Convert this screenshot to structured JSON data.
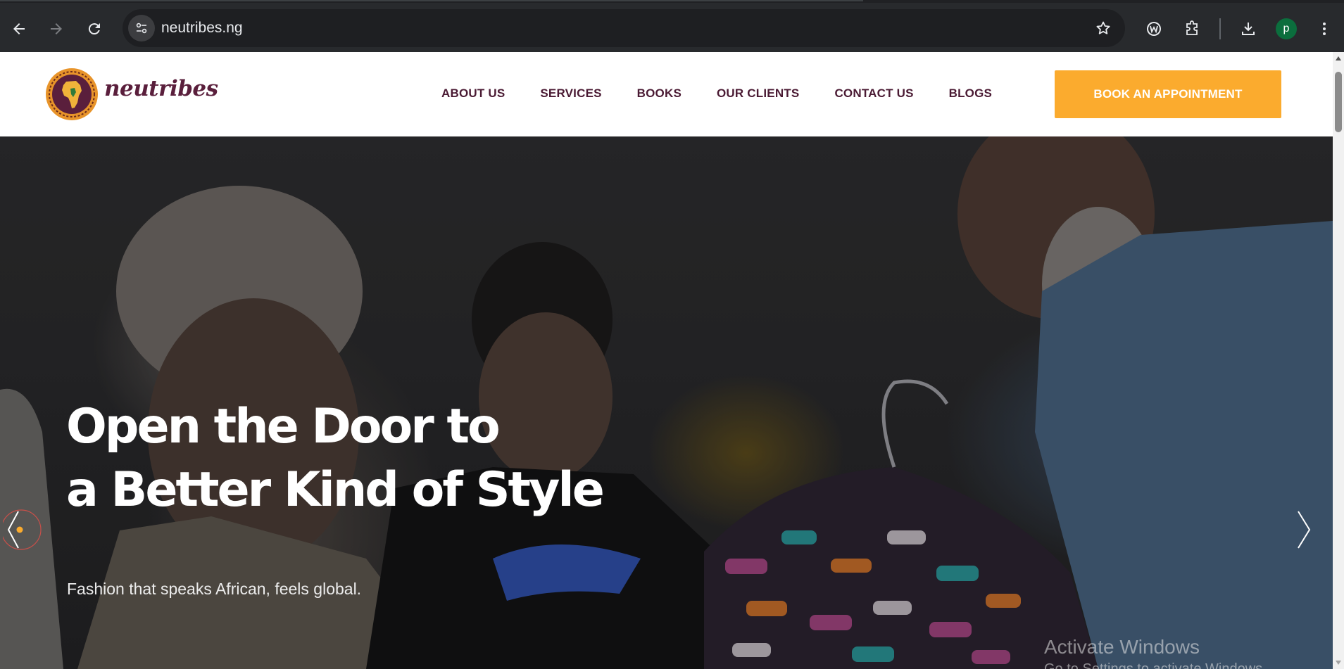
{
  "browser": {
    "url": "neutribes.ng",
    "profile_initial": "p",
    "icons": [
      "back-icon",
      "forward-icon",
      "reload-icon",
      "site-info-icon",
      "star-icon",
      "extension-w-icon",
      "extensions-puzzle-icon",
      "download-icon",
      "menu-dots-icon"
    ]
  },
  "site": {
    "logo_text": "neutribes",
    "nav": [
      {
        "label": "ABOUT US"
      },
      {
        "label": "SERVICES"
      },
      {
        "label": "BOOKS"
      },
      {
        "label": "OUR CLIENTS"
      },
      {
        "label": "CONTACT US"
      },
      {
        "label": "BLOGS"
      }
    ],
    "cta_label": "BOOK AN APPOINTMENT",
    "colors": {
      "brand_maroon": "#4a1a33",
      "cta_orange": "#fbab2e"
    }
  },
  "hero": {
    "title_line1": "Open the Door to",
    "title_line2": "a Better Kind of Style",
    "subtitle": "Fashion that speaks African, feels global."
  },
  "os_watermark": {
    "title": "Activate Windows",
    "subtitle": "Go to Settings to activate Windows."
  }
}
